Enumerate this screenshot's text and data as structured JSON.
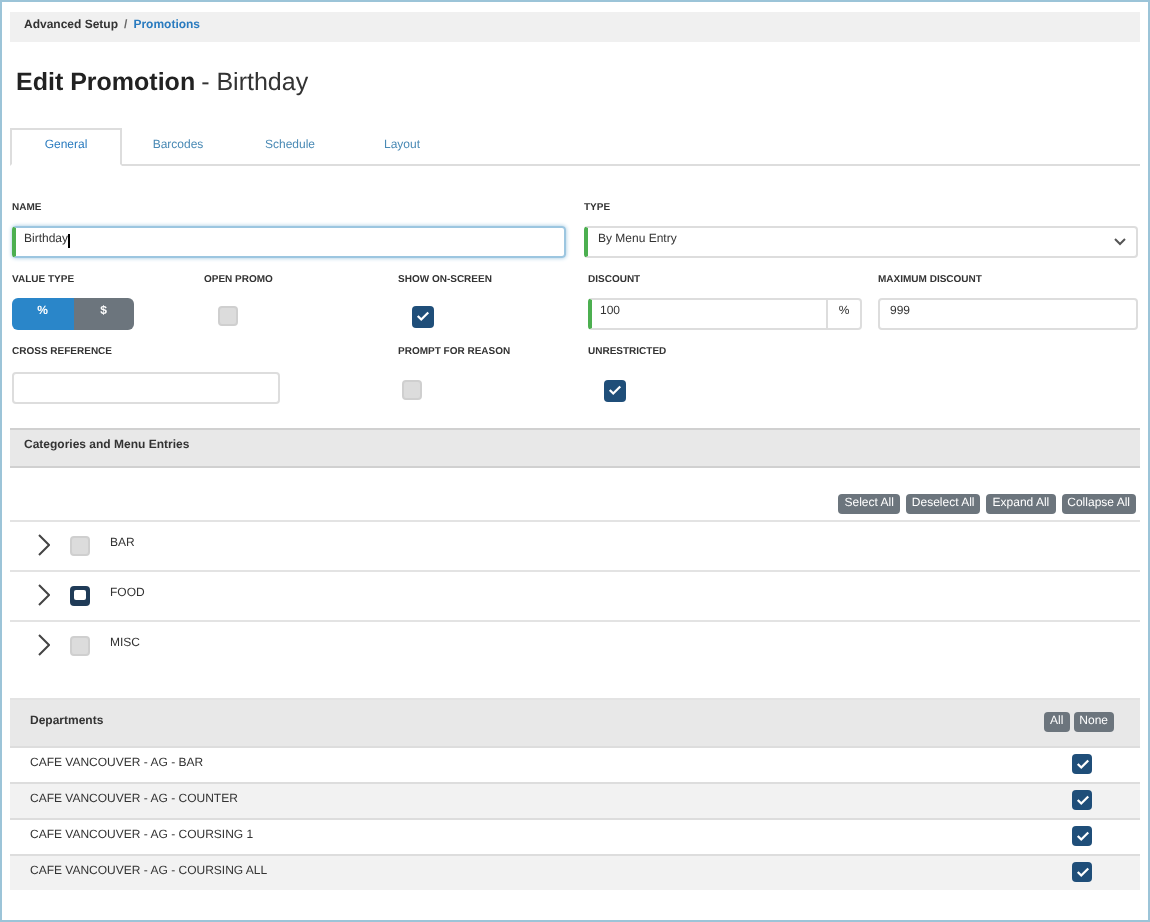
{
  "breadcrumb": {
    "separator": "/",
    "items": [
      {
        "label": "Advanced Setup",
        "link": false
      },
      {
        "label": "Promotions",
        "link": true
      }
    ]
  },
  "title": {
    "main": "Edit Promotion",
    "sub": "- Birthday"
  },
  "tabs": [
    {
      "label": "General",
      "selected": true
    },
    {
      "label": "Barcodes",
      "selected": false
    },
    {
      "label": "Schedule",
      "selected": false
    },
    {
      "label": "Layout",
      "selected": false
    }
  ],
  "name": {
    "label": "NAME",
    "value": "Birthday"
  },
  "type": {
    "label": "TYPE",
    "value": "By Menu Entry"
  },
  "value_type": {
    "label": "VALUE TYPE",
    "options": [
      {
        "label": "%",
        "selected": true
      },
      {
        "label": "$",
        "selected": false
      }
    ]
  },
  "open_promo": {
    "label": "OPEN PROMO",
    "checked": false
  },
  "show_on_screen": {
    "label": "SHOW ON-SCREEN",
    "checked": true
  },
  "discount": {
    "label": "DISCOUNT",
    "value": "100",
    "unit": "%"
  },
  "maximum_discount": {
    "label": "MAXIMUM DISCOUNT",
    "value": "999"
  },
  "cross_reference": {
    "label": "CROSS REFERENCE"
  },
  "prompt_for_reason": {
    "label": "PROMPT FOR REASON",
    "checked": false
  },
  "unrestricted": {
    "label": "UNRESTRICTED",
    "checked": true
  },
  "categories": {
    "title": "Categories and Menu Entries",
    "buttons": [
      "Select All",
      "Deselect All",
      "Expand All",
      "Collapse All"
    ],
    "items": [
      {
        "label": "BAR",
        "checked": false,
        "partial": false
      },
      {
        "label": "FOOD",
        "checked": false,
        "partial": true
      },
      {
        "label": "MISC",
        "checked": false,
        "partial": false
      }
    ]
  },
  "departments": {
    "title": "Departments",
    "buttons": [
      "All",
      "None"
    ],
    "rows": [
      {
        "name": "CAFE VANCOUVER - AG - BAR",
        "checked": true
      },
      {
        "name": "CAFE VANCOUVER - AG - COUNTER",
        "checked": true
      },
      {
        "name": "CAFE VANCOUVER - AG - COURSING 1",
        "checked": true
      },
      {
        "name": "CAFE VANCOUVER - AG - COURSING ALL",
        "checked": true
      }
    ]
  }
}
